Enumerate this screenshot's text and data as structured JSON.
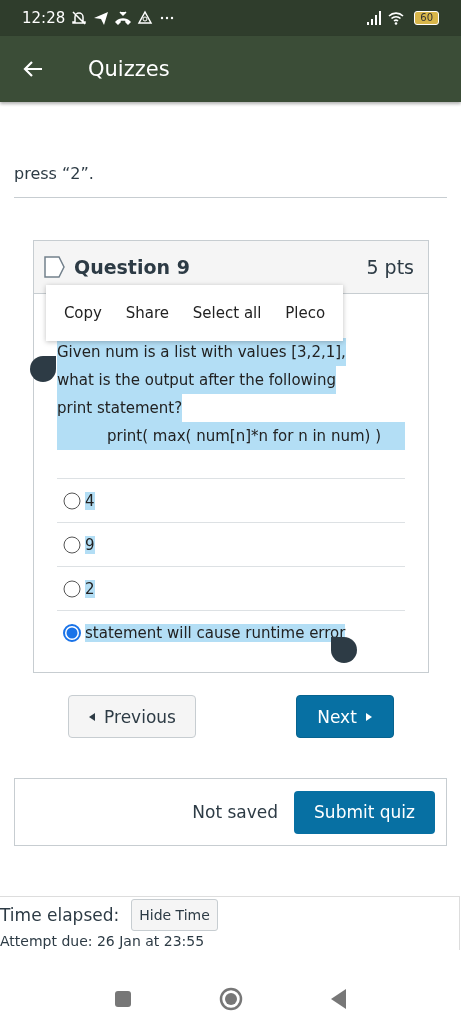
{
  "status_bar": {
    "time": "12:28",
    "battery": "60"
  },
  "app_bar": {
    "title": "Quizzes"
  },
  "intro": {
    "text": "press “2”."
  },
  "question": {
    "title": "Question 9",
    "points": "5 pts",
    "text_lines": [
      "Given num is a list with values [3,2,1],",
      "what is the output after the following",
      "print statement?"
    ],
    "code": "print( max( num[n]*n for n in num) )",
    "answers": [
      {
        "label": "4",
        "selected": false
      },
      {
        "label": "9",
        "selected": false
      },
      {
        "label": "2",
        "selected": false
      },
      {
        "label": "statement will cause runtime error",
        "selected": true
      }
    ]
  },
  "context_menu": [
    "Copy",
    "Share",
    "Select all",
    "Pleco"
  ],
  "nav": {
    "previous": "Previous",
    "next": "Next"
  },
  "submit": {
    "status": "Not saved",
    "button": "Submit quiz"
  },
  "timer": {
    "label": "Time elapsed:",
    "button": "Hide Time",
    "due": "Attempt due: 26 Jan at 23:55"
  }
}
